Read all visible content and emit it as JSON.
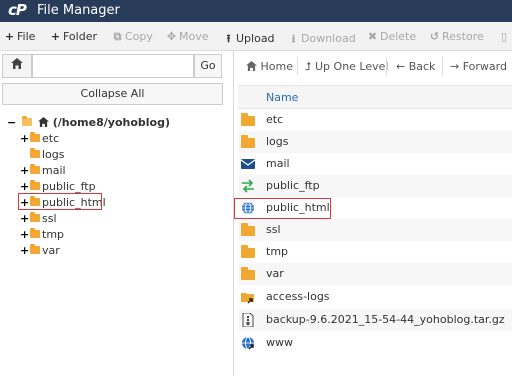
{
  "app": {
    "logo_text": "cP",
    "title": "File Manager"
  },
  "toolbar": [
    {
      "icon": "+",
      "label": "File",
      "enabled": true
    },
    {
      "icon": "+",
      "label": "Folder",
      "enabled": true
    },
    {
      "icon": "⧉",
      "label": "Copy",
      "enabled": false
    },
    {
      "icon": "✥",
      "label": "Move",
      "enabled": false
    },
    {
      "icon": "⭱",
      "label": "Upload",
      "enabled": true
    },
    {
      "icon": "⭳",
      "label": "Download",
      "enabled": false
    },
    {
      "icon": "✖",
      "label": "Delete",
      "enabled": false
    },
    {
      "icon": "↺",
      "label": "Restore",
      "enabled": false
    }
  ],
  "left_pane": {
    "search_value": "",
    "go_label": "Go",
    "collapse_label": "Collapse All",
    "tree_root": "(/home8/yohoblog)",
    "tree": [
      {
        "name": "etc",
        "expandable": true
      },
      {
        "name": "logs",
        "expandable": false
      },
      {
        "name": "mail",
        "expandable": true
      },
      {
        "name": "public_ftp",
        "expandable": true
      },
      {
        "name": "public_html",
        "expandable": true,
        "highlighted": true
      },
      {
        "name": "ssl",
        "expandable": true
      },
      {
        "name": "tmp",
        "expandable": true
      },
      {
        "name": "var",
        "expandable": true
      }
    ]
  },
  "nav": {
    "home": "Home",
    "up": "Up One Level",
    "back": "Back",
    "forward": "Forward"
  },
  "list": {
    "column_name": "Name",
    "files": [
      {
        "name": "etc",
        "icon": "folder-icon"
      },
      {
        "name": "logs",
        "icon": "folder-icon"
      },
      {
        "name": "mail",
        "icon": "mail-icon"
      },
      {
        "name": "public_ftp",
        "icon": "ftp-arrows-icon"
      },
      {
        "name": "public_html",
        "icon": "globe-icon",
        "highlighted": true
      },
      {
        "name": "ssl",
        "icon": "folder-icon"
      },
      {
        "name": "tmp",
        "icon": "folder-icon"
      },
      {
        "name": "var",
        "icon": "folder-icon"
      },
      {
        "name": "access-logs",
        "icon": "folder-link-icon"
      },
      {
        "name": "backup-9.6.2021_15-54-44_yohoblog.tar.gz",
        "icon": "archive-icon"
      },
      {
        "name": "www",
        "icon": "globe-link-icon"
      }
    ]
  },
  "colors": {
    "titlebar": "#283c5a",
    "highlight": "#d9383e",
    "folder": "#f0a830",
    "link": "#2a6ab5"
  }
}
